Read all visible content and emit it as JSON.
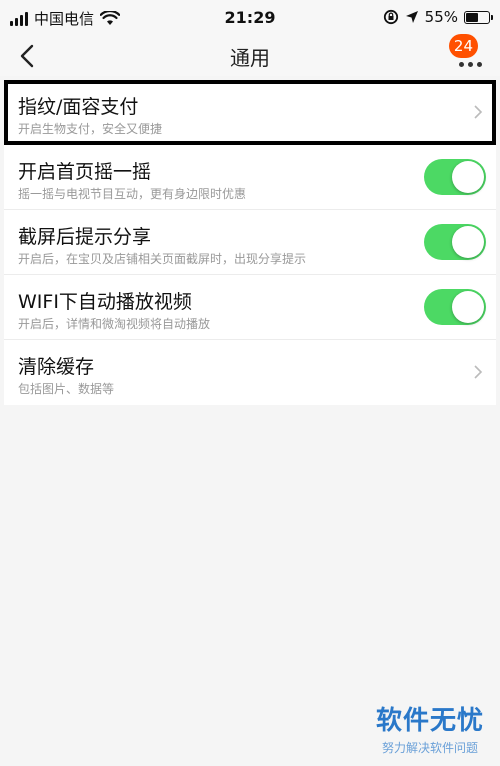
{
  "status": {
    "carrier": "中国电信",
    "time": "21:29",
    "battery": "55%",
    "battery_level": 0.55
  },
  "nav": {
    "title": "通用",
    "badge": "24"
  },
  "items": [
    {
      "title": "指纹/面容支付",
      "sub": "开启生物支付，安全又便捷",
      "control": "chevron"
    },
    {
      "title": "开启首页摇一摇",
      "sub": "摇一摇与电视节目互动，更有身边限时优惠",
      "control": "toggle",
      "on": true
    },
    {
      "title": "截屏后提示分享",
      "sub": "开启后，在宝贝及店铺相关页面截屏时，出现分享提示",
      "control": "toggle",
      "on": true
    },
    {
      "title": "WIFI下自动播放视频",
      "sub": "开启后，详情和微淘视频将自动播放",
      "control": "toggle",
      "on": true
    },
    {
      "title": "清除缓存",
      "sub": "包括图片、数据等",
      "control": "chevron"
    }
  ],
  "watermark": {
    "brand": "软件无忧",
    "slogan": "努力解决软件问题"
  },
  "colors": {
    "toggle_on": "#4cd964",
    "badge": "#ff5000",
    "watermark": "#2a78c9"
  }
}
